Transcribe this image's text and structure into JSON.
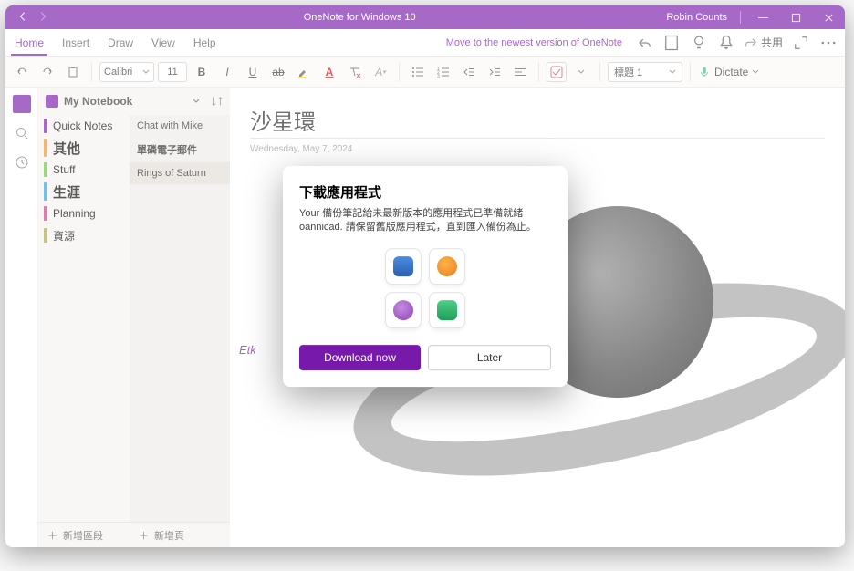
{
  "titlebar": {
    "app_title": "OneNote for Windows 10",
    "user": "Robin Counts"
  },
  "menu": {
    "home": "Home",
    "insert": "Insert",
    "draw": "Draw",
    "view": "View",
    "help": "Help",
    "move_newest": "Move to the newest version of OneNote",
    "share": "共用"
  },
  "toolbar": {
    "font_name": "Calibri",
    "font_size": "11",
    "heading_style": "標題 1",
    "dictate": "Dictate"
  },
  "notebook": {
    "label": "My Notebook",
    "sections": [
      {
        "name": "Quick Notes",
        "color": "#7719aa"
      },
      {
        "name": "其他",
        "color": "#e8912d"
      },
      {
        "name": "Stuff",
        "color": "#6bbf3b"
      },
      {
        "name": "生涯",
        "color": "#2aa0d8"
      },
      {
        "name": "Planning",
        "color": "#c83a7a"
      },
      {
        "name": "資源",
        "color": "#a8a144"
      }
    ],
    "pages": [
      {
        "name": "Chat with Mike"
      },
      {
        "name": "單磷電子郵件"
      },
      {
        "name": "Rings of Saturn"
      }
    ],
    "add_section": "新增區段",
    "add_page": "新增頁"
  },
  "page": {
    "title": "沙星環",
    "date": "Wednesday, May 7, 2024",
    "etk": "Etk"
  },
  "dialog": {
    "title": "下載應用程式",
    "body": "Your 備份筆記給未最新版本的應用程式已準備就緒 oannicad. 請保留舊版應用程式，直到匯入備份為止。",
    "download": "Download now",
    "later": "Later"
  }
}
